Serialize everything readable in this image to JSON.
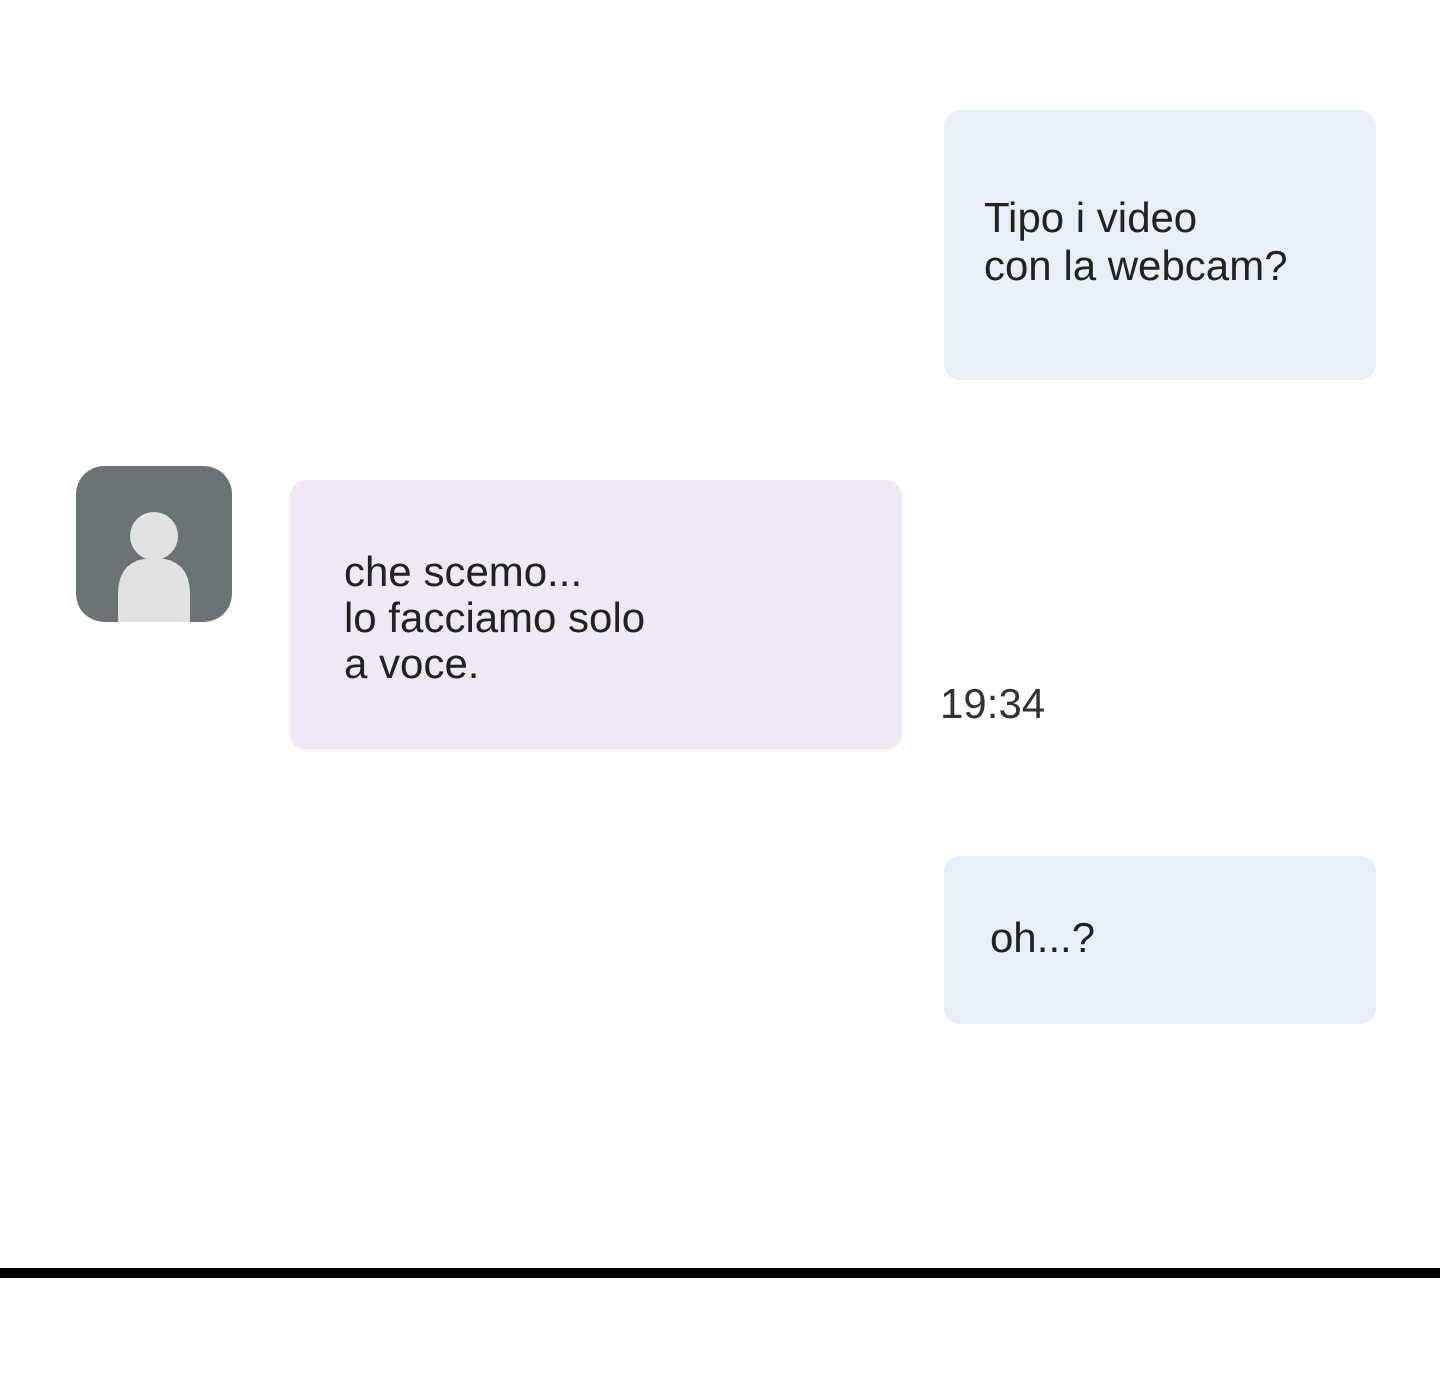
{
  "messages": [
    {
      "kind": "outgoing",
      "text": "Tipo i video\ncon la webcam?"
    },
    {
      "kind": "incoming",
      "text": "che scemo...\nlo facciamo solo\na voce.",
      "time": "19:34"
    },
    {
      "kind": "outgoing",
      "text": "oh...?"
    }
  ]
}
